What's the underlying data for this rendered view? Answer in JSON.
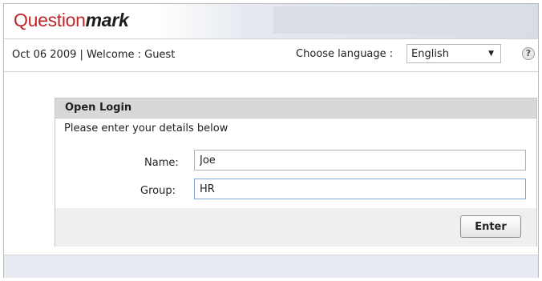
{
  "header": {
    "logo_part1": "Question",
    "logo_part2": "mark"
  },
  "infobar": {
    "date_welcome": "Oct 06 2009 | Welcome : Guest",
    "language_label": "Choose language :",
    "language_value": "English",
    "help_glyph": "?"
  },
  "login": {
    "title": "Open Login",
    "instructions": "Please enter your details below",
    "name_label": "Name:",
    "name_value": "Joe",
    "group_label": "Group:",
    "group_value": "HR",
    "enter_label": "Enter"
  },
  "colors": {
    "brand_red": "#c0252b",
    "focus_border": "#7fa7da"
  }
}
